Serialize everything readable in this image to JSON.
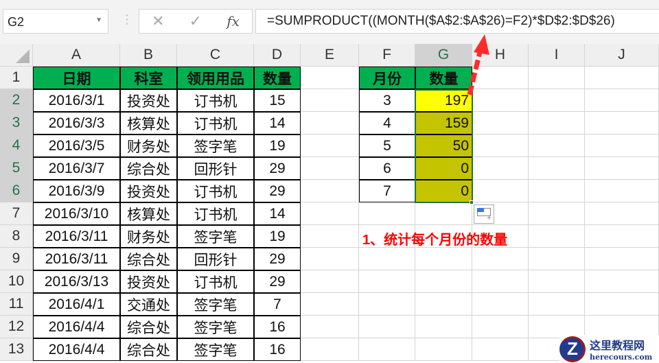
{
  "name_box": "G2",
  "formula_bar": {
    "cancel": "✕",
    "enter": "✓",
    "fx": "fx",
    "formula": "=SUMPRODUCT((MONTH($A$2:$A$26)=F2)*$D$2:$D$26)"
  },
  "columns": [
    "A",
    "B",
    "C",
    "D",
    "E",
    "F",
    "G",
    "H",
    "I",
    "J"
  ],
  "rows": [
    "1",
    "2",
    "3",
    "4",
    "5",
    "6",
    "7",
    "8",
    "9",
    "10",
    "11",
    "12",
    "13"
  ],
  "headers": [
    "日期",
    "科室",
    "领用用品",
    "数量"
  ],
  "data": [
    [
      "2016/3/1",
      "投资处",
      "订书机",
      "15"
    ],
    [
      "2016/3/3",
      "核算处",
      "订书机",
      "14"
    ],
    [
      "2016/3/5",
      "财务处",
      "签字笔",
      "19"
    ],
    [
      "2016/3/7",
      "综合处",
      "回形针",
      "29"
    ],
    [
      "2016/3/9",
      "投资处",
      "订书机",
      "29"
    ],
    [
      "2016/3/10",
      "核算处",
      "订书机",
      "14"
    ],
    [
      "2016/3/11",
      "财务处",
      "签字笔",
      "19"
    ],
    [
      "2016/3/11",
      "综合处",
      "回形针",
      "29"
    ],
    [
      "2016/3/13",
      "投资处",
      "订书机",
      "29"
    ],
    [
      "2016/4/1",
      "交通处",
      "签字笔",
      "7"
    ],
    [
      "2016/4/4",
      "综合处",
      "签字笔",
      "16"
    ],
    [
      "2016/4/4",
      "综合处",
      "签字笔",
      "16"
    ]
  ],
  "summary_headers": [
    "月份",
    "数量"
  ],
  "summary": [
    [
      "3",
      "197"
    ],
    [
      "4",
      "159"
    ],
    [
      "5",
      "50"
    ],
    [
      "6",
      "0"
    ],
    [
      "7",
      "0"
    ]
  ],
  "note": "1、统计每个月份的数量",
  "watermark": {
    "name": "这里教程网",
    "url": "herecours.com",
    "letter": "Z"
  },
  "colors": {
    "header_green": "#00b050",
    "highlight_yellow": "#ffff00",
    "olive": "#c4c400",
    "arrow_red": "#ff2b2b"
  }
}
